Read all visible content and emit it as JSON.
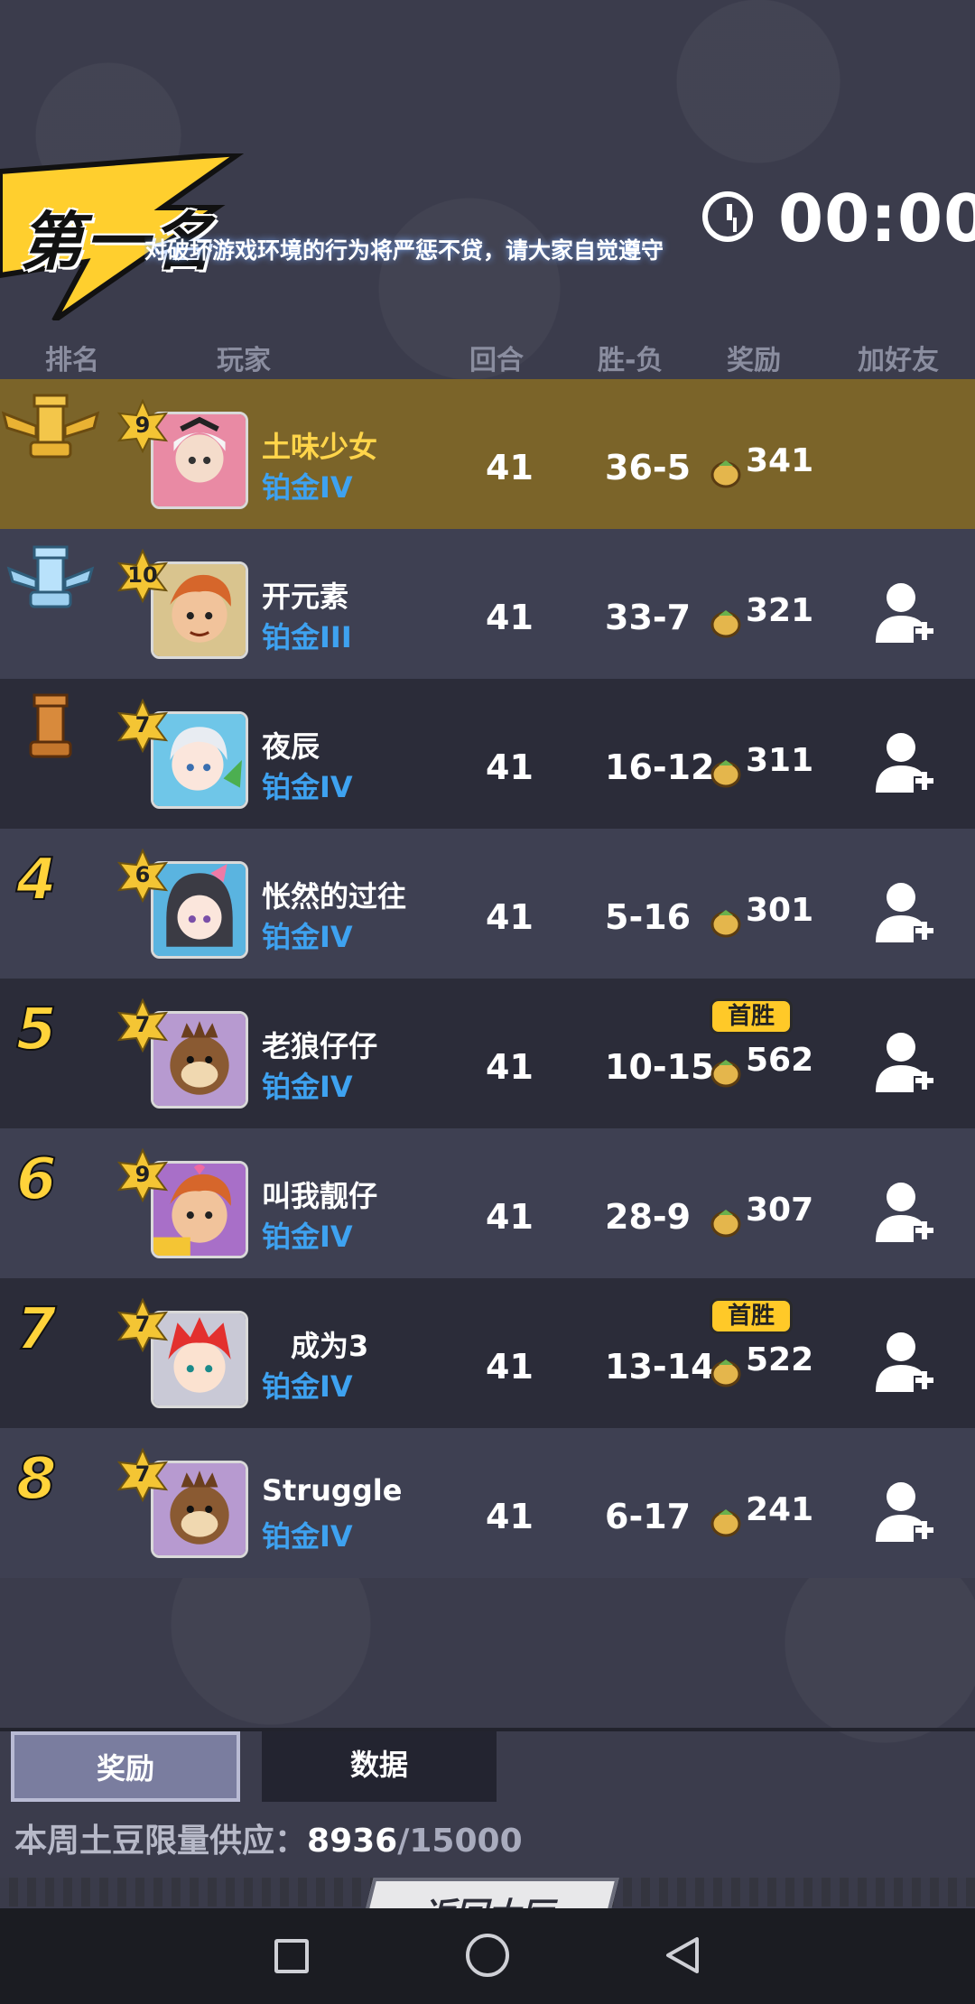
{
  "header": {
    "rank_title": "第一名",
    "marquee": "对破坏游戏环境的行为将严惩不贷，请大家自觉遵守",
    "timer": "00:00"
  },
  "columns": [
    "排名",
    "玩家",
    "回合",
    "胜-负",
    "奖励",
    "加好友"
  ],
  "rows": [
    {
      "rank": "1",
      "level": "9",
      "name": "土味少女",
      "tier": "铂金IV",
      "rounds": "41",
      "wl": "36-5",
      "reward": "341",
      "first_win": "",
      "add_friend": false
    },
    {
      "rank": "2",
      "level": "10",
      "name": "开元素",
      "tier": "铂金III",
      "rounds": "41",
      "wl": "33-7",
      "reward": "321",
      "first_win": "",
      "add_friend": true
    },
    {
      "rank": "3",
      "level": "7",
      "name": "夜辰",
      "tier": "铂金IV",
      "rounds": "41",
      "wl": "16-12",
      "reward": "311",
      "first_win": "",
      "add_friend": true
    },
    {
      "rank": "4",
      "level": "6",
      "name": "怅然的过往",
      "tier": "铂金IV",
      "rounds": "41",
      "wl": "5-16",
      "reward": "301",
      "first_win": "",
      "add_friend": true
    },
    {
      "rank": "5",
      "level": "7",
      "name": "老狼仔仔",
      "tier": "铂金IV",
      "rounds": "41",
      "wl": "10-15",
      "reward": "562",
      "first_win": "首胜",
      "add_friend": true
    },
    {
      "rank": "6",
      "level": "9",
      "name": "叫我靓仔",
      "tier": "铂金IV",
      "rounds": "41",
      "wl": "28-9",
      "reward": "307",
      "first_win": "",
      "add_friend": true
    },
    {
      "rank": "7",
      "level": "7",
      "name": "成为3",
      "tier": "铂金IV",
      "rounds": "41",
      "wl": "13-14",
      "reward": "522",
      "first_win": "首胜",
      "add_friend": true
    },
    {
      "rank": "8",
      "level": "7",
      "name": "Struggle",
      "tier": "铂金IV",
      "rounds": "41",
      "wl": "6-17",
      "reward": "241",
      "first_win": "",
      "add_friend": true
    }
  ],
  "tabs": {
    "rewards": "奖励",
    "stats": "数据"
  },
  "supply": {
    "label": "本周土豆限量供应：",
    "current": "8936",
    "max": "/15000"
  },
  "back_button": "返回大厅",
  "colors": {
    "gold_row": "#7b6429",
    "tier_blue": "#3ea2f0",
    "badge_yellow": "#ffc928"
  },
  "icons": {
    "trophy_1": "gold-tower-trophy",
    "trophy_2": "silver-tower-trophy",
    "trophy_3": "bronze-tower-trophy",
    "reward": "potato-coin-icon",
    "add_friend": "add-friend-icon",
    "timer": "clock-icon"
  }
}
